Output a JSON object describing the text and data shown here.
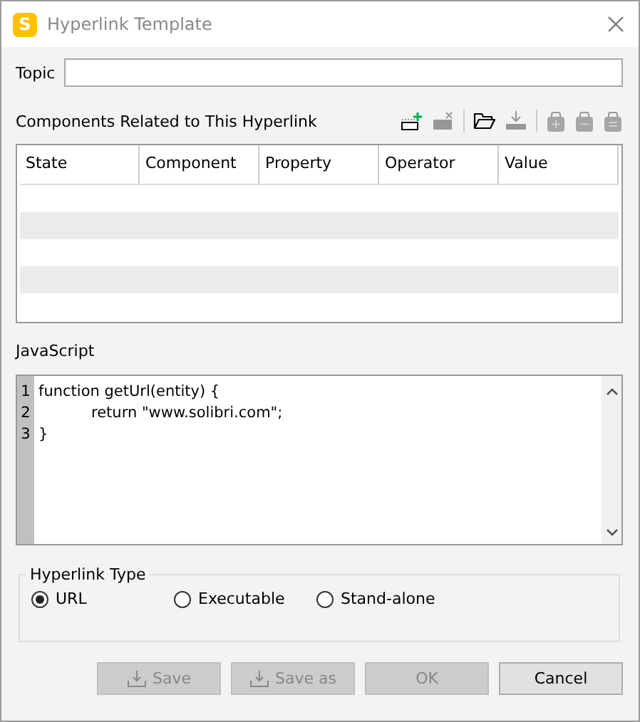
{
  "window": {
    "title": "Hyperlink Template",
    "logo": "S"
  },
  "topic": {
    "label": "Topic"
  },
  "components": {
    "heading": "Components Related to This Hyperlink",
    "toolbar": [
      {
        "kind": "add-row",
        "disabled": false
      },
      {
        "kind": "remove-row",
        "disabled": true
      },
      {
        "kind": "separator"
      },
      {
        "kind": "open",
        "disabled": false
      },
      {
        "kind": "import",
        "disabled": true
      },
      {
        "kind": "separator"
      },
      {
        "kind": "bag-plus",
        "disabled": true
      },
      {
        "kind": "bag-minus",
        "disabled": true
      },
      {
        "kind": "bag-equal",
        "disabled": true
      }
    ],
    "columns": [
      "State",
      "Component",
      "Property",
      "Operator",
      "Value"
    ]
  },
  "javascript": {
    "label": "JavaScript",
    "lines": [
      {
        "number": "1",
        "text": "function getUrl(entity) {"
      },
      {
        "number": "2",
        "text": "\treturn \"www.solibri.com\";"
      },
      {
        "number": "3",
        "text": "}"
      }
    ]
  },
  "hyperlink_type": {
    "legend": "Hyperlink Type",
    "options": [
      {
        "label": "URL",
        "selected": true
      },
      {
        "label": "Executable",
        "selected": false
      },
      {
        "label": "Stand-alone",
        "selected": false
      }
    ]
  },
  "buttons": [
    {
      "label": "Save",
      "icon": true,
      "disabled": true
    },
    {
      "label": "Save as",
      "icon": true,
      "disabled": true
    },
    {
      "label": "OK",
      "icon": false,
      "disabled": true
    },
    {
      "label": "Cancel",
      "icon": false,
      "disabled": false
    }
  ]
}
